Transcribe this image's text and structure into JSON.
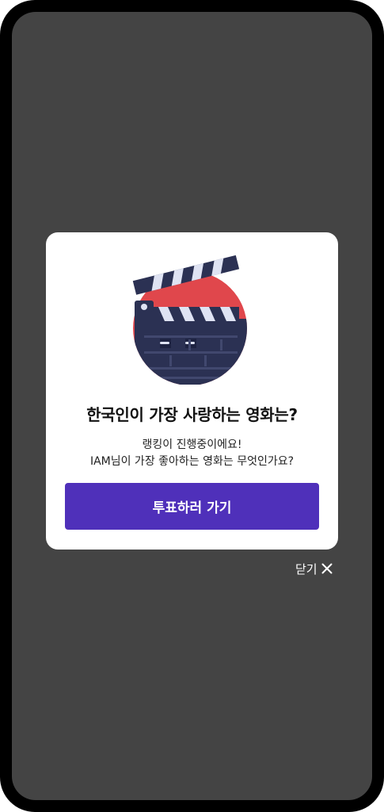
{
  "modal": {
    "title": "한국인이 가장 사랑하는 영화는?",
    "message_line1": "랭킹이 진행중이에요!",
    "message_line2": "IAM님이 가장 좋아하는 영화는 무엇인가요?",
    "cta_label": "투표하러 가기",
    "illustration_icon": "clapperboard-icon"
  },
  "close": {
    "label": "닫기",
    "icon": "close-icon"
  },
  "colors": {
    "overlay": "#444444",
    "card": "#ffffff",
    "accent": "#4f30ba",
    "illustration_circle": "#e0474c",
    "clapper_dark": "#2b3153"
  }
}
